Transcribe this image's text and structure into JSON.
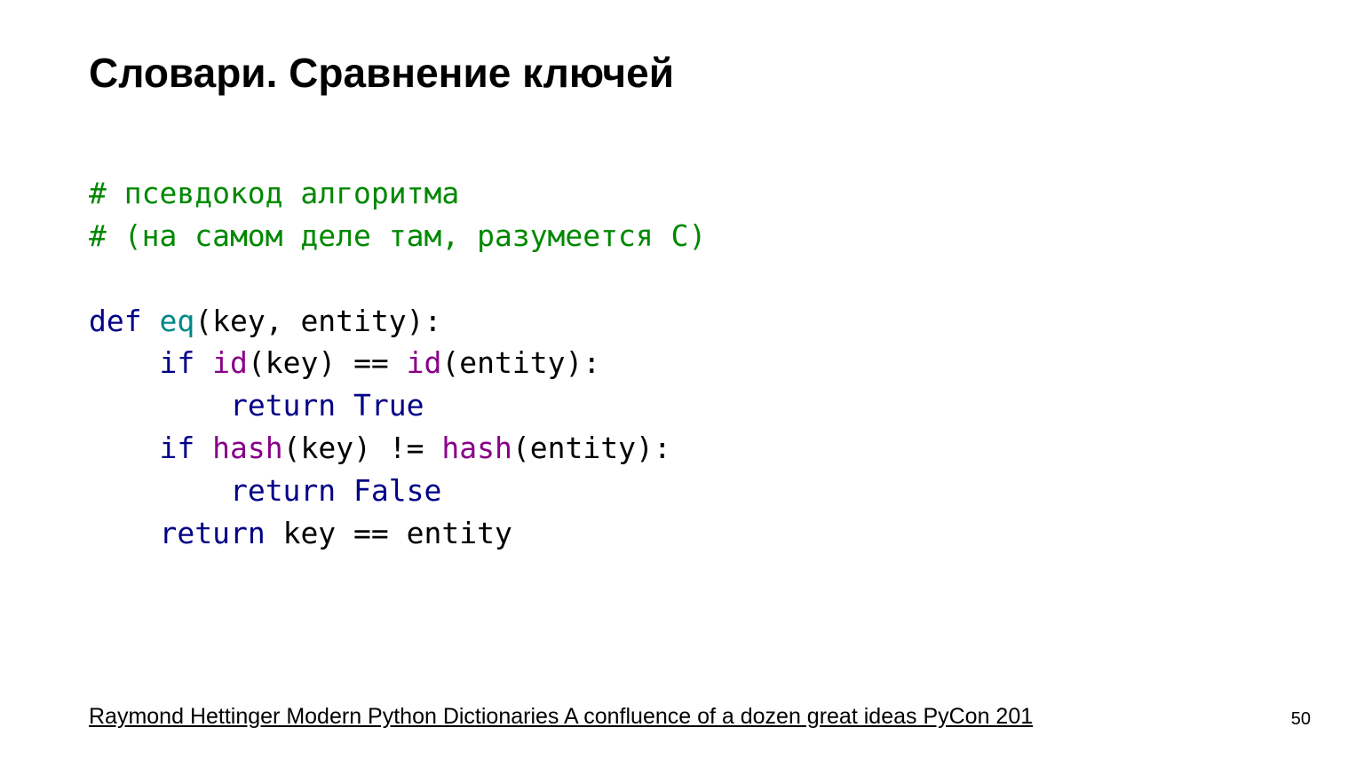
{
  "slide": {
    "title": "Словари. Сравнение ключей",
    "code": {
      "comment1": "# псевдокод алгоритма",
      "comment2": "# (на самом деле там, разумеется С)",
      "kw_def": "def",
      "funcname": "eq",
      "sig_rest": "(key, entity):",
      "kw_if1": "if",
      "bi_id1": "id",
      "line2_mid": "(key) == ",
      "bi_id2": "id",
      "line2_end": "(entity):",
      "kw_return1": "return",
      "const_true": "True",
      "kw_if2": "if",
      "bi_hash1": "hash",
      "line4_mid": "(key) != ",
      "bi_hash2": "hash",
      "line4_end": "(entity):",
      "kw_return2": "return",
      "const_false": "False",
      "kw_return3": "return",
      "line6_rest": " key == entity"
    },
    "footer": "Raymond Hettinger Modern Python Dictionaries A confluence of a dozen great ideas PyCon 201",
    "page_number": "50"
  }
}
